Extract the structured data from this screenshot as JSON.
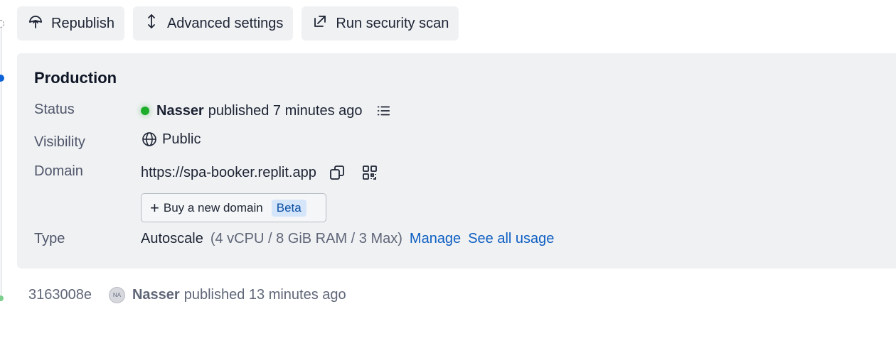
{
  "toolbar": {
    "republish_label": "Republish",
    "advanced_label": "Advanced settings",
    "scan_label": "Run security scan"
  },
  "production": {
    "title": "Production",
    "status": {
      "label": "Status",
      "user": "Nasser",
      "text": "published 7 minutes ago",
      "color": "#1cae2b"
    },
    "visibility": {
      "label": "Visibility",
      "value": "Public"
    },
    "domain": {
      "label": "Domain",
      "value": "https://spa-booker.replit.app",
      "buy_label": "Buy a new domain",
      "buy_badge": "Beta"
    },
    "type": {
      "label": "Type",
      "value": "Autoscale",
      "specs": "(4 vCPU / 8 GiB RAM / 3 Max)",
      "manage_link": "Manage",
      "usage_link": "See all usage"
    }
  },
  "history": [
    {
      "id": "3163008e",
      "avatar": "NA",
      "user": "Nasser",
      "text": "published 13 minutes ago"
    }
  ],
  "colors": {
    "accent": "#0e62d8",
    "link": "#0e5fc2",
    "panel_bg": "#f0f1f3"
  }
}
